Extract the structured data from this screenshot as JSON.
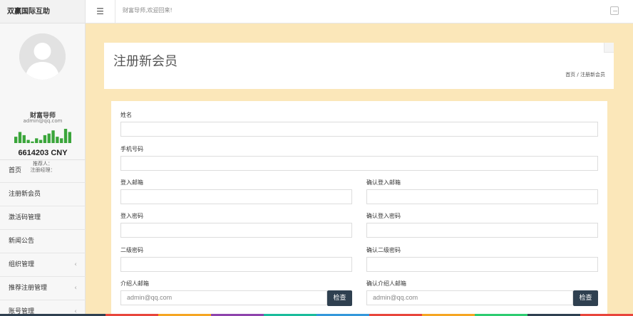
{
  "sidebar": {
    "brand": "双赢国际互助",
    "profile": {
      "name": "财富导师",
      "email": "admin@qq.com",
      "balance": "6614203 CNY",
      "referrer": "推荐人：",
      "register_manager": "注册经理："
    },
    "sparkline": [
      4,
      7,
      5,
      2,
      1,
      3,
      2,
      5,
      6,
      8,
      4,
      3,
      9,
      7
    ],
    "items": [
      {
        "label": "首页",
        "chevron": ""
      },
      {
        "label": "注册新会员",
        "chevron": ""
      },
      {
        "label": "激活码管理",
        "chevron": ""
      },
      {
        "label": "新闻公告",
        "chevron": ""
      },
      {
        "label": "组织管理",
        "chevron": "‹"
      },
      {
        "label": "推荐注册管理",
        "chevron": "‹"
      },
      {
        "label": "账号管理",
        "chevron": "‹"
      }
    ]
  },
  "topbar": {
    "menu_icon": "☰",
    "welcome": "财富导师,欢迎回来!"
  },
  "page": {
    "title": "注册新会员",
    "breadcrumb": "首页  /  注册新会员"
  },
  "form": {
    "name_label": "姓名",
    "phone_label": "手机号码",
    "email_label": "登入邮箱",
    "email_confirm_label": "确认登入邮箱",
    "password_label": "登入密码",
    "password_confirm_label": "确认登入密码",
    "pin_label": "二级密码",
    "pin_confirm_label": "确认二级密码",
    "intro_email_label": "介绍人邮箱",
    "intro_email_confirm_label": "确认介绍人邮箱",
    "intro_email_value": "admin@qq.com",
    "intro_email_confirm_value": "admin@qq.com",
    "check_label": "检查"
  },
  "colors": {
    "accent": "#2f4050",
    "background": "#fbe7b9",
    "sparkline": "#3aa53a",
    "bottom_bar": [
      "#2f4050",
      "#2f4050",
      "#e8453c",
      "#f5a623",
      "#8e44ad",
      "#1abc9c",
      "#3498db",
      "#e8453c",
      "#f5a623",
      "#2ecc71",
      "#2f4050",
      "#e8453c"
    ]
  }
}
